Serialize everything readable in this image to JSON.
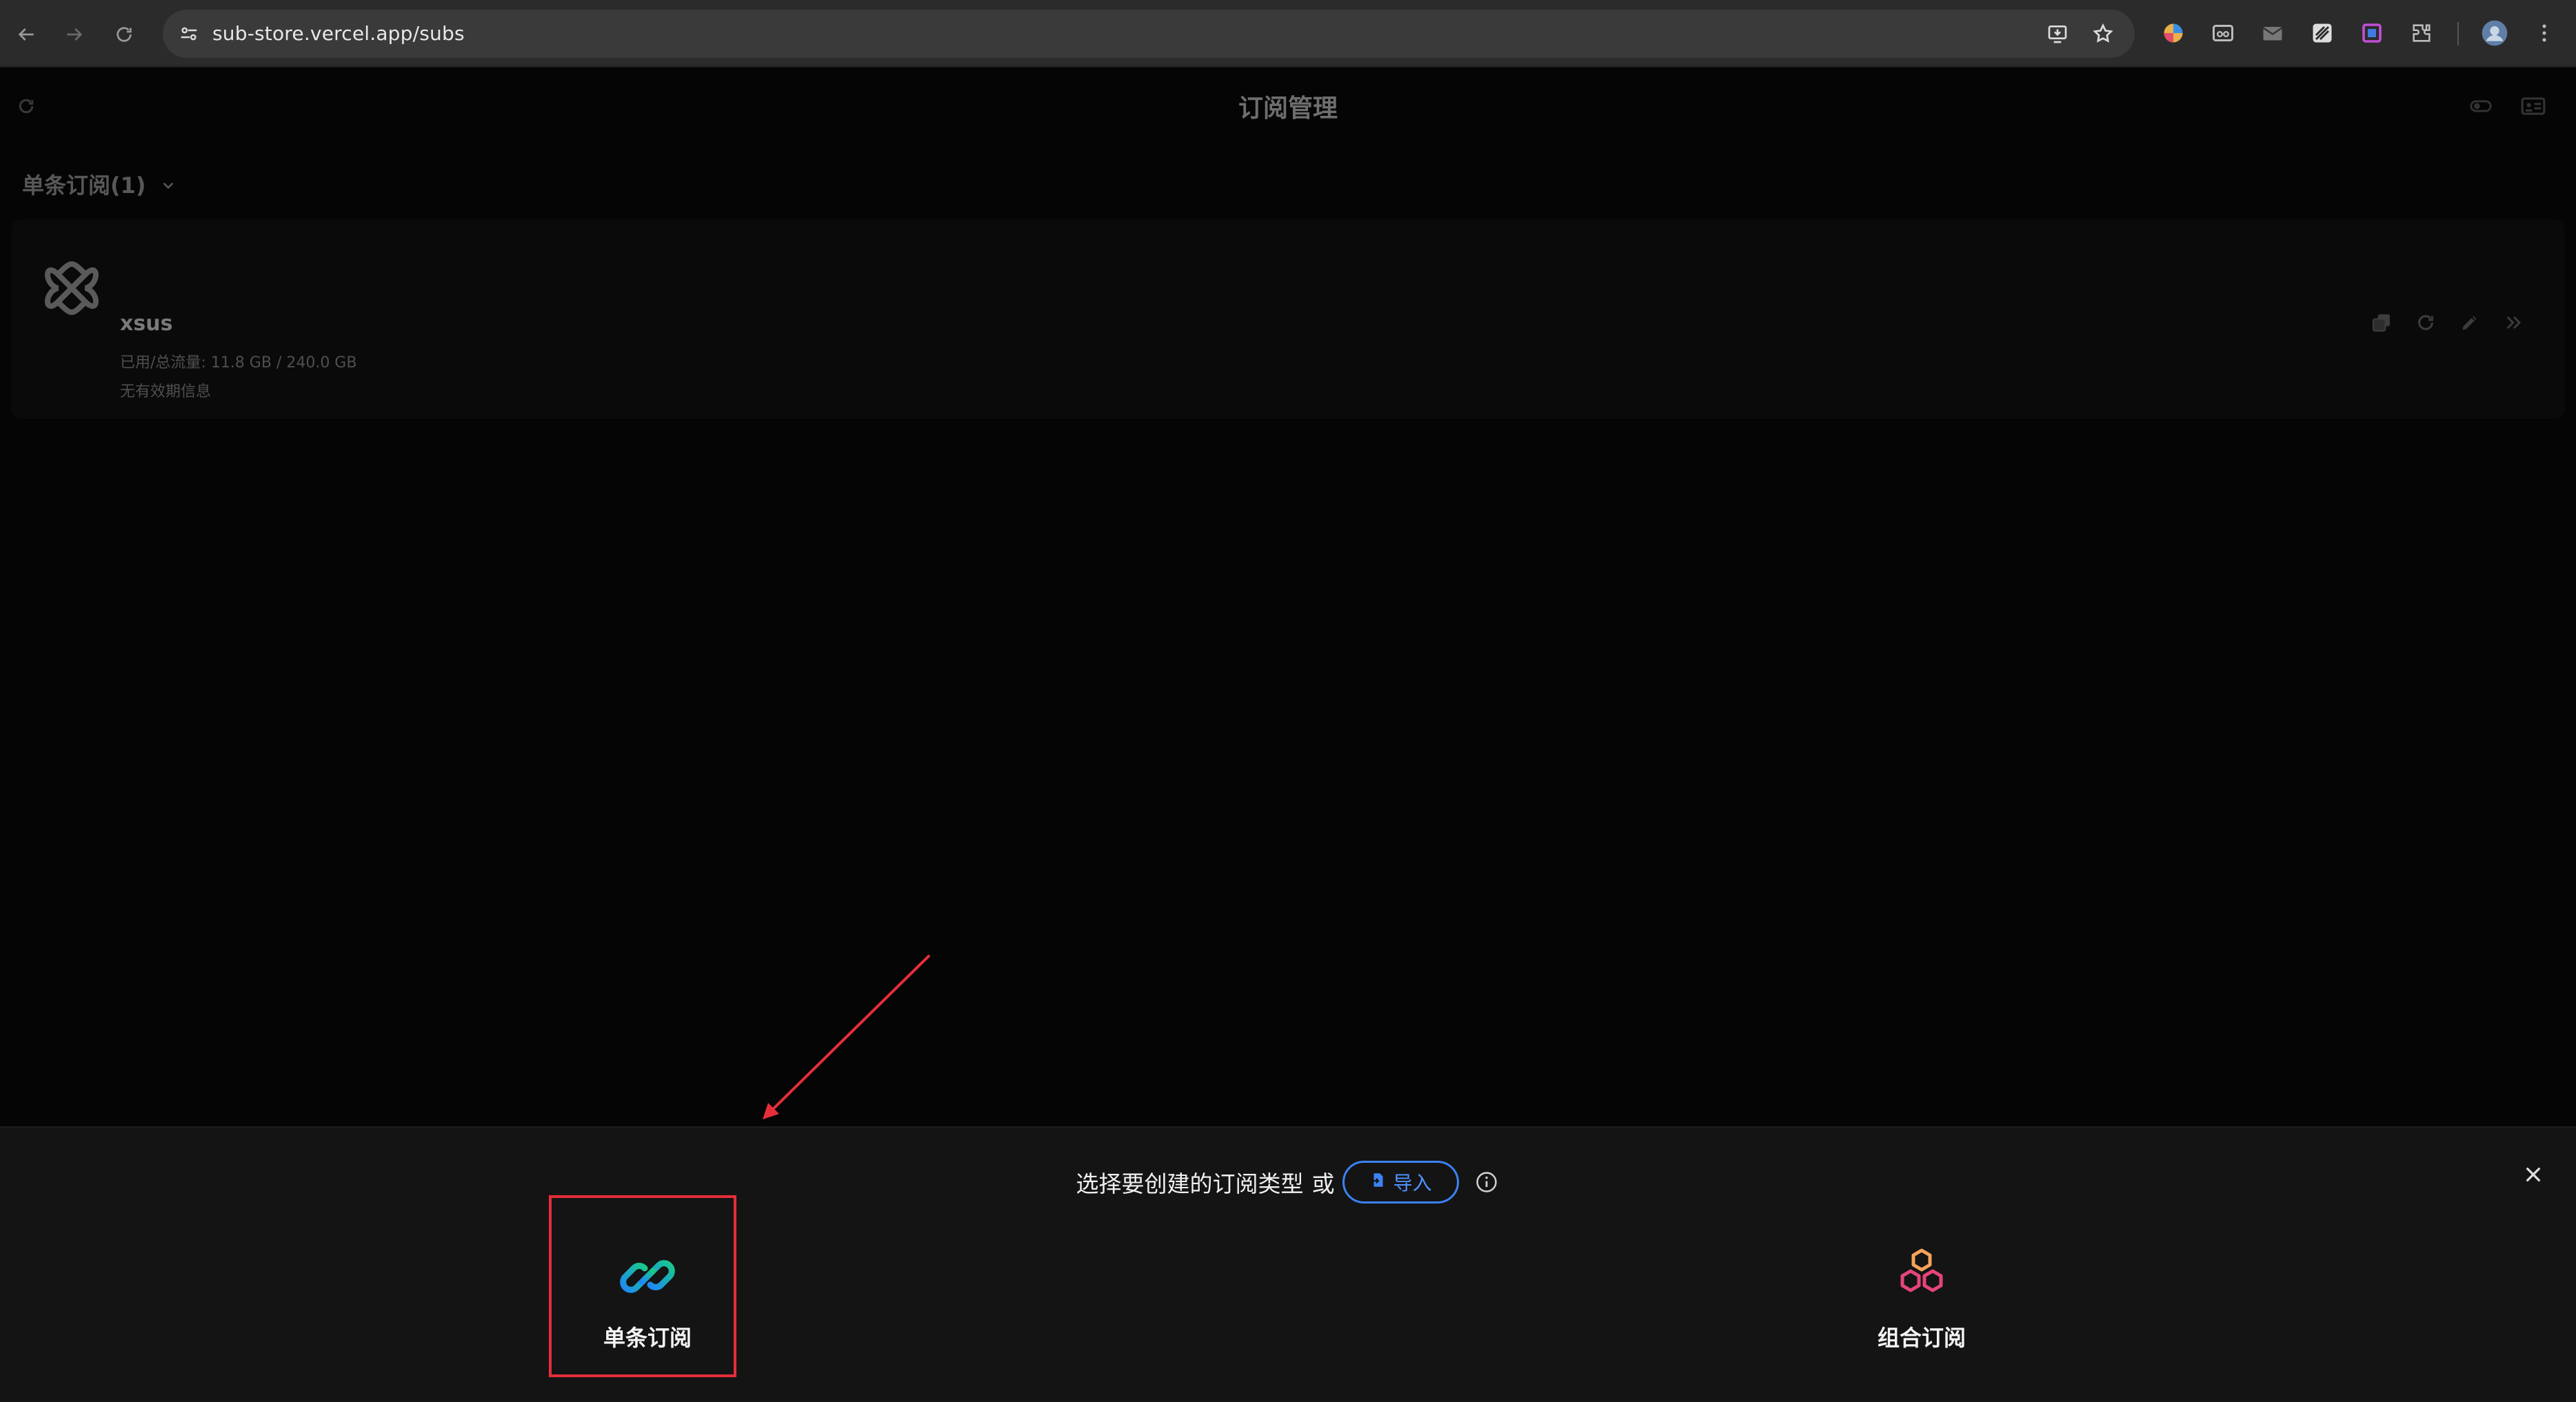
{
  "browser": {
    "url": "sub-store.vercel.app/subs",
    "icons": [
      "back-icon",
      "forward-icon",
      "reload-icon",
      "site-info-icon",
      "install-app-icon",
      "bookmark-star-icon",
      "extensions-icon",
      "profile-avatar-icon",
      "more-menu-icon"
    ]
  },
  "header": {
    "title": "订阅管理"
  },
  "group": {
    "title": "单条订阅(1)"
  },
  "subscriptions": [
    {
      "name": "xsus",
      "usage": "已用/总流量: 11.8 GB / 240.0 GB",
      "expiry": "无有效期信息"
    }
  ],
  "sheet": {
    "prompt": "选择要创建的订阅类型",
    "or": "或",
    "import_label": "导入",
    "options": [
      {
        "label": "单条订阅",
        "icon": "link-icon"
      },
      {
        "label": "组合订阅",
        "icon": "hexagons-icon"
      }
    ]
  },
  "colors": {
    "accent_blue": "#3b82f6",
    "highlight_red": "#e52e3a",
    "link_gradient_start": "#19c98a",
    "link_gradient_end": "#1e88f5",
    "hex_orange": "#f5a25a",
    "hex_pink": "#e5457a"
  }
}
